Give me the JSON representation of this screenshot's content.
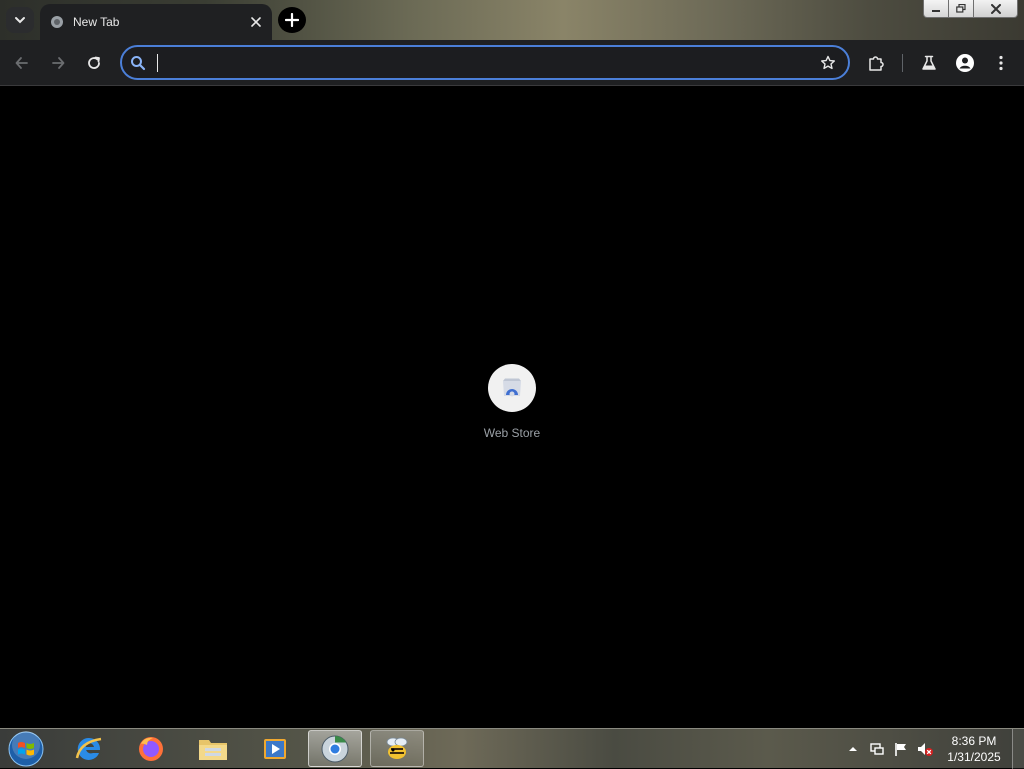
{
  "browser": {
    "tab": {
      "title": "New Tab",
      "favicon": "globe-icon",
      "close_icon": "close-icon"
    },
    "tab_search_icon": "chevron-down-icon",
    "new_tab_icon": "plus-icon",
    "window_controls": [
      "minimize-icon",
      "restore-icon",
      "close-icon"
    ],
    "toolbar": {
      "back_icon": "arrow-left-icon",
      "forward_icon": "arrow-right-icon",
      "reload_icon": "reload-icon",
      "omnibox": {
        "value": "",
        "placeholder": "",
        "search_icon": "search-icon",
        "bookmark_icon": "star-icon"
      },
      "extensions_icon": "puzzle-icon",
      "labs_icon": "flask-icon",
      "profile_icon": "person-icon",
      "menu_icon": "more-vert-icon"
    },
    "accent_color": "#4b7fd8"
  },
  "new_tab_page": {
    "shortcuts": [
      {
        "label": "Web Store",
        "icon": "web-store-icon"
      }
    ]
  },
  "taskbar": {
    "start_icon": "windows-orb-icon",
    "apps": [
      {
        "name": "Internet Explorer",
        "icon": "ie-icon"
      },
      {
        "name": "Firefox",
        "icon": "firefox-icon"
      },
      {
        "name": "Windows Explorer",
        "icon": "folder-icon"
      },
      {
        "name": "Media Player",
        "icon": "media-player-icon"
      },
      {
        "name": "Chrome",
        "icon": "chrome-icon"
      },
      {
        "name": "Bee",
        "icon": "bee-icon"
      }
    ],
    "tray_icons": [
      "show-hidden-icon",
      "network-icon",
      "action-center-flag-icon",
      "volume-muted-icon"
    ],
    "clock": {
      "time": "8:36 PM",
      "date": "1/31/2025"
    }
  }
}
